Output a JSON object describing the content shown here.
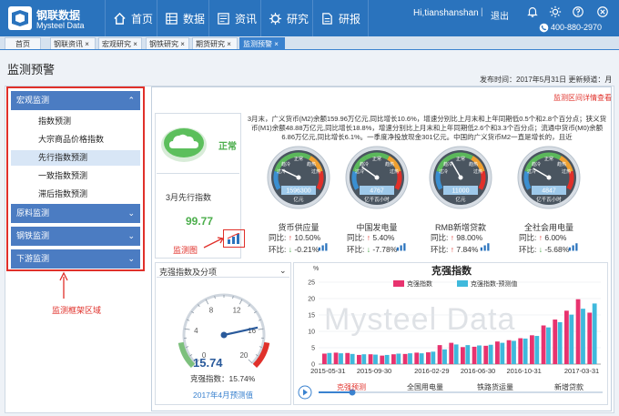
{
  "header": {
    "brand_cn": "钢联数据",
    "brand_en": "Mysteel Data",
    "nav": [
      {
        "label": "首页",
        "icon": "home-icon"
      },
      {
        "label": "数据",
        "icon": "data-grid-icon"
      },
      {
        "label": "资讯",
        "icon": "news-icon"
      },
      {
        "label": "研究",
        "icon": "research-gear-icon"
      },
      {
        "label": "研报",
        "icon": "report-icon"
      }
    ],
    "user": "Hi,tianshanshan",
    "separator": "|",
    "logout": "退出",
    "phone": "400-880-2970"
  },
  "tabs": [
    {
      "label": "首页"
    },
    {
      "label": "钢联资讯 ×"
    },
    {
      "label": "宏观研究 ×"
    },
    {
      "label": "钢铁研究 ×"
    },
    {
      "label": "期货研究 ×"
    },
    {
      "label": "监测预警 ×",
      "active": true
    }
  ],
  "page": {
    "title": "监测预警",
    "publish_info": "发布时间：2017年5月31日    更新频道：月"
  },
  "sidebar": {
    "sections": [
      {
        "label": "宏观监测",
        "chevron": "⌃"
      },
      {
        "label": "原料监测",
        "chevron": "⌄"
      },
      {
        "label": "钢铁监测",
        "chevron": "⌄"
      },
      {
        "label": "下游监测",
        "chevron": "⌄"
      }
    ],
    "items": [
      {
        "label": "指数预测"
      },
      {
        "label": "大宗商品价格指数"
      },
      {
        "label": "先行指数预测",
        "selected": true
      },
      {
        "label": "一致指数预测"
      },
      {
        "label": "滞后指数预测"
      }
    ],
    "frame_label": "监测框架区域"
  },
  "main": {
    "detail_link": "监测区间详情查看",
    "status": "正常",
    "index_name": "3月先行指数",
    "index_value": "99.77",
    "monitor_label": "监测图",
    "description": "3月末，广义货币(M2)余额159.96万亿元,同比增长10.6%，增速分别比上月末和上年同期低0.5个和2.8个百分点；狭义货币(M1)余额48.88万亿元,同比增长18.8%，增速分别比上月末和上年同期低2.6个和3.3个百分点；流通中货币(M0)余额6.86万亿元,同比增长6.1%。一季度净投放现金301亿元。中国的广义货币M2一直是增长的，且近",
    "gauge_ticks": [
      "正常",
      "过冷",
      "趋冷",
      "趋热",
      "过热"
    ],
    "gauges": [
      {
        "name": "货币供应量",
        "value": "1596300",
        "unit": "亿元",
        "yoy_label": "同比:",
        "yoy": "10.50%",
        "yoy_dir": "up",
        "mom_label": "环比:",
        "mom": "-0.21%",
        "mom_dir": "down"
      },
      {
        "name": "中国发电量",
        "value": "4767",
        "unit": "亿千瓦小时",
        "yoy_label": "同比:",
        "yoy": "5.40%",
        "yoy_dir": "up",
        "mom_label": "环比:",
        "mom": "-7.78%",
        "mom_dir": "down"
      },
      {
        "name": "RMB新增贷款",
        "value": "11000",
        "unit": "亿元",
        "yoy_label": "同比:",
        "yoy": "98.00%",
        "yoy_dir": "up",
        "mom_label": "环比:",
        "mom": "7.84%",
        "mom_dir": "up"
      },
      {
        "name": "全社会用电量",
        "value": "4847",
        "unit": "亿千瓦小时",
        "yoy_label": "同比:",
        "yoy": "6.00%",
        "yoy_dir": "up",
        "mom_label": "环比:",
        "mom": "-5.68%",
        "mom_dir": "down"
      }
    ],
    "bottom_left": {
      "dropdown": "克强指数及分项",
      "chevron": "⌄",
      "gauge_ticks": [
        "0",
        "4",
        "8",
        "12",
        "16",
        "20"
      ],
      "gauge_value": 15.74,
      "value_text": "15.74",
      "index_text": "克强指数：15.74%",
      "prediction": "2017年4月预测值"
    },
    "timeline": {
      "labels": [
        "克强预测",
        "全国用电量",
        "铁路货运量",
        "新增贷款"
      ],
      "play_icon": "play-icon"
    },
    "watermark": "Mysteel Data"
  },
  "colors": {
    "header_bg": "#2a73bd",
    "menu_bg": "#4b7cc2",
    "highlight_red": "#e0302a",
    "status_green": "#4cae4c",
    "series_pink": "#e8336f",
    "series_cyan": "#3fb9dc"
  },
  "chart_data": {
    "type": "bar",
    "title": "克强指数",
    "ylabel": "%",
    "xlabel": "",
    "ylim": [
      0,
      25
    ],
    "yticks": [
      "0",
      "5",
      "10",
      "15",
      "20",
      "25"
    ],
    "xtick_labels": [
      "2015-05-31",
      "2015-09-30",
      "2016-02-29",
      "2016-06-30",
      "2016-10-31",
      "2017-03-31"
    ],
    "legend_position": "top",
    "categories": [
      "2015-05",
      "2015-06",
      "2015-07",
      "2015-08",
      "2015-09",
      "2015-10",
      "2015-11",
      "2015-12",
      "2016-01",
      "2016-02",
      "2016-03",
      "2016-04",
      "2016-05",
      "2016-06",
      "2016-07",
      "2016-08",
      "2016-09",
      "2016-10",
      "2016-11",
      "2016-12",
      "2017-01",
      "2017-02",
      "2017-03",
      "2017-04"
    ],
    "series": [
      {
        "name": "克强指数",
        "color": "#e8336f",
        "values": [
          3.2,
          3.5,
          3.4,
          2.8,
          3.0,
          2.6,
          3.0,
          3.1,
          3.5,
          3.6,
          5.8,
          6.5,
          5.2,
          5.3,
          5.6,
          6.9,
          7.3,
          7.9,
          8.8,
          11.8,
          13.6,
          16.3,
          19.8,
          15.7
        ]
      },
      {
        "name": "克强指数-预测值",
        "color": "#3fb9dc",
        "values": [
          3.4,
          3.3,
          3.1,
          3.0,
          2.9,
          2.8,
          3.2,
          3.3,
          3.3,
          3.8,
          4.5,
          6.0,
          5.8,
          5.7,
          5.9,
          6.5,
          7.1,
          7.8,
          8.6,
          11.2,
          12.8,
          15.1,
          16.9,
          18.5
        ]
      }
    ]
  }
}
